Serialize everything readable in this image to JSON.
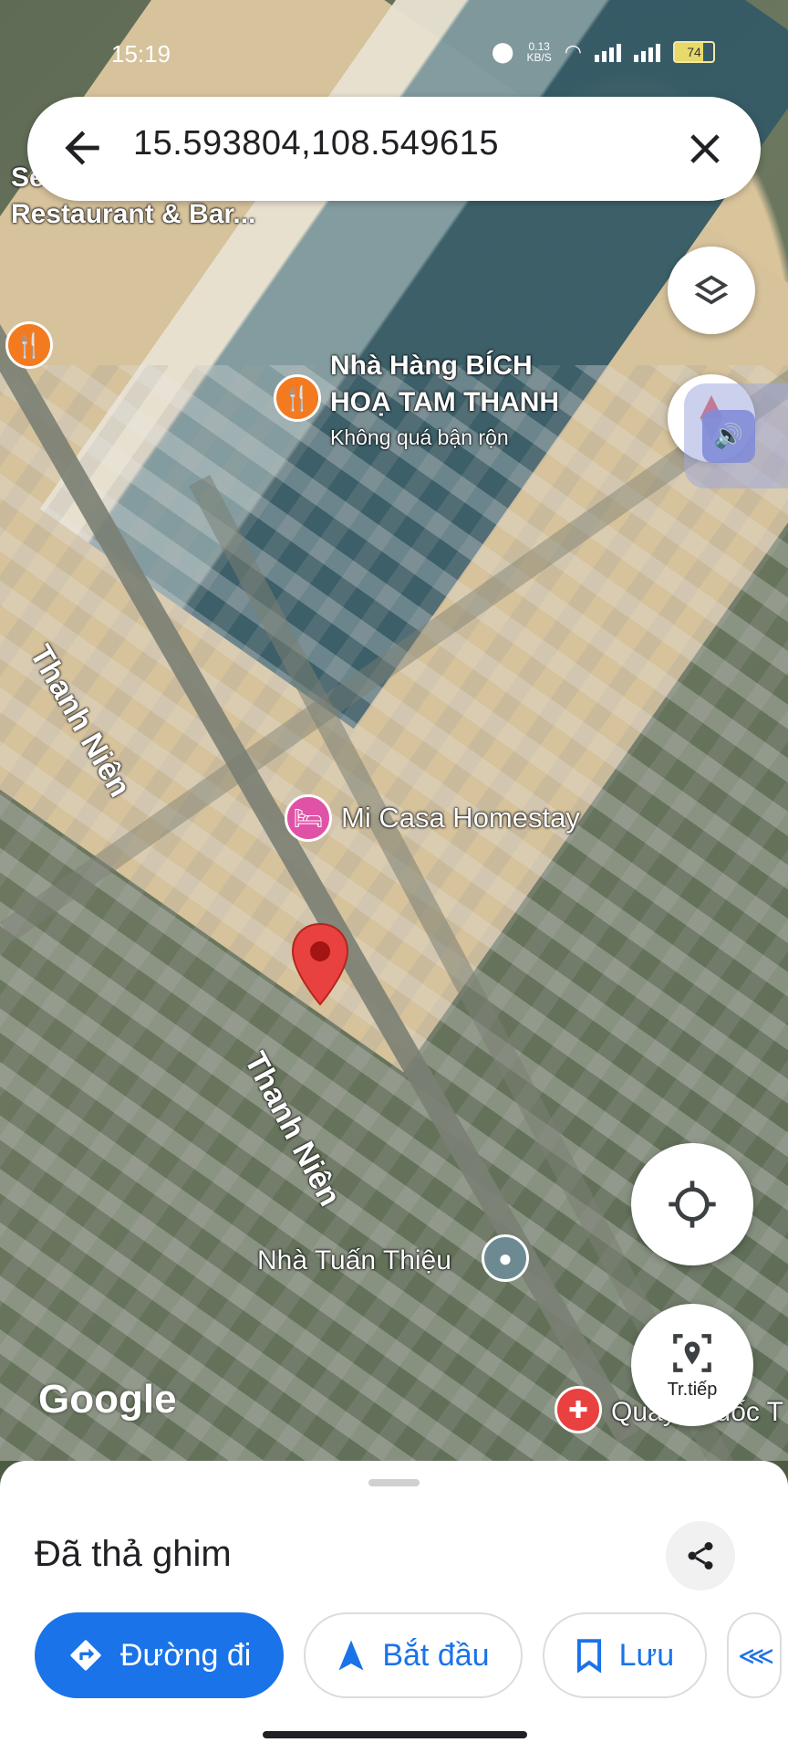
{
  "status": {
    "time": "15:19",
    "net_speed": "0.13",
    "net_unit": "KB/S",
    "battery": "74"
  },
  "search": {
    "query": "15.593804,108.549615"
  },
  "map": {
    "labels": {
      "restaurant_bar": "Restaurant & Bar...",
      "restaurant_bar_cut": "Se",
      "bich_hoa_line1": "Nhà Hàng BÍCH",
      "bich_hoa_line2": "HOẠ TAM THANH",
      "bich_hoa_status": "Không quá bận rộn",
      "street_1": "Thanh Niên",
      "street_2": "Thanh Niên",
      "homestay": "Mi Casa Homestay",
      "tuan_thieu": "Nhà Tuấn Thiệu",
      "quay_thuoc": "Quầy Thuốc T"
    },
    "attribution": "Google",
    "live_button_label": "Tr.tiếp"
  },
  "sheet": {
    "title": "Đã thả ghim",
    "actions": [
      {
        "label": "Đường đi"
      },
      {
        "label": "Bắt đầu"
      },
      {
        "label": "Lưu"
      }
    ]
  },
  "colors": {
    "accent": "#1a73e8",
    "pin": "#e8413f",
    "poi_food": "#f47a20",
    "poi_hotel": "#e052a6"
  }
}
